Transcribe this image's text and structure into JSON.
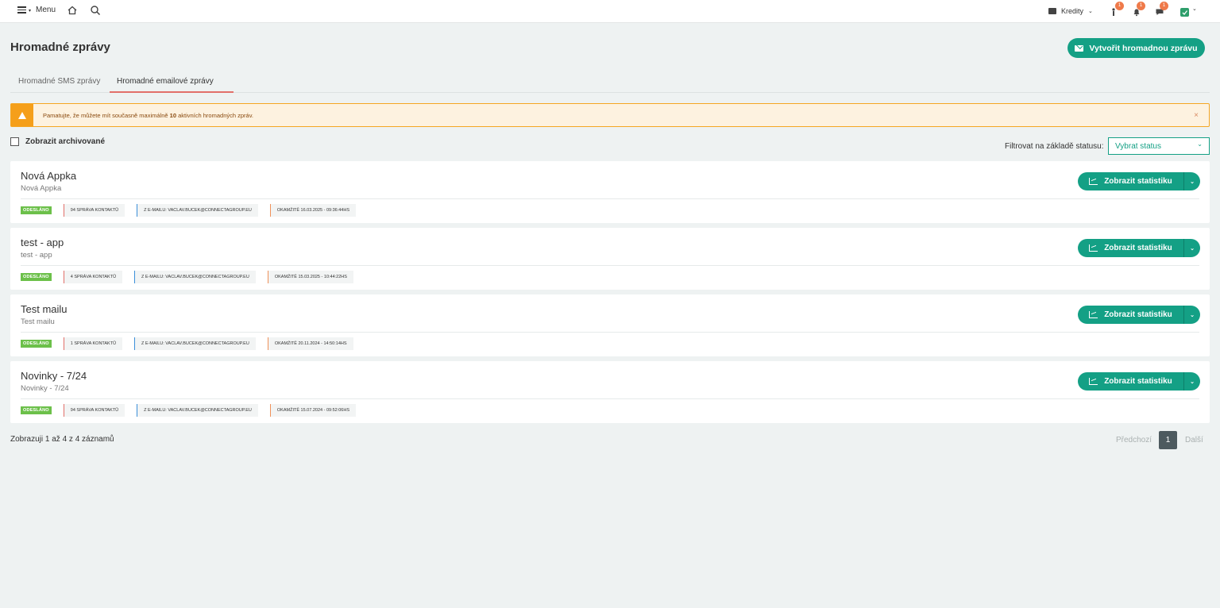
{
  "topbar": {
    "menu_label": "Menu",
    "credits_label": "Kredity",
    "badges": {
      "user": "1",
      "notifications": "1",
      "messages": "1"
    }
  },
  "page": {
    "title": "Hromadné zprávy",
    "create_button": "Vytvořit hromadnou zprávu"
  },
  "tabs": [
    {
      "label": "Hromadné SMS zprávy"
    },
    {
      "label": "Hromadné emailové zprávy"
    }
  ],
  "alert": {
    "text_before": "Pamatujte, že můžete mít současně maximálně ",
    "text_bold": "10",
    "text_after": " aktivních hromadných zpráv.",
    "close": "×"
  },
  "filters": {
    "archived_label": "Zobrazit archivované",
    "status_label": "Filtrovat na základě statusu:",
    "status_select": "Vybrat status"
  },
  "stats_button_label": "Zobrazit statistiku",
  "messages": [
    {
      "title": "Nová Appka",
      "subtitle": "Nová Appka",
      "status": "ODESLÁNO",
      "contacts": "94 SPRÁVA KONTAKTŮ",
      "from": "Z E-MAILU: VACLAV.BUCEK@CONNECTAGROUP.EU",
      "time": "OKAMŽITĚ 16.03.2025 - 09:36:44HS"
    },
    {
      "title": "test - app",
      "subtitle": "test - app",
      "status": "ODESLÁNO",
      "contacts": "4 SPRÁVA KONTAKTŮ",
      "from": "Z E-MAILU: VACLAV.BUCEK@CONNECTAGROUP.EU",
      "time": "OKAMŽITĚ 15.03.2025 - 10:44:22HS"
    },
    {
      "title": "Test mailu",
      "subtitle": "Test mailu",
      "status": "ODESLÁNO",
      "contacts": "1 SPRÁVA KONTAKTŮ",
      "from": "Z E-MAILU: VACLAV.BUCEK@CONNECTAGROUP.EU",
      "time": "OKAMŽITĚ 20.11.2024 - 14:50:14HS"
    },
    {
      "title": "Novinky - 7/24",
      "subtitle": "Novinky - 7/24",
      "status": "ODESLÁNO",
      "contacts": "94 SPRÁVA KONTAKTŮ",
      "from": "Z E-MAILU: VACLAV.BUCEK@CONNECTAGROUP.EU",
      "time": "OKAMŽITĚ 15.07.2024 - 09:52:06HS"
    }
  ],
  "pagination": {
    "info": "Zobrazuji 1 až 4 z 4 záznamů",
    "prev": "Předchozí",
    "current": "1",
    "next": "Další"
  },
  "colors": {
    "accent": "#14a085",
    "status_badge": "#6cc04a",
    "alert_bg": "#fdf2e0",
    "alert_icon": "#f59f1a",
    "tab_underline": "#e2706a",
    "badge": "#ef7a4a"
  },
  "icons": {
    "menu": "hamburger-icon",
    "home": "home-icon",
    "search": "search-icon",
    "credits": "wallet-icon",
    "user": "person-icon",
    "notifications": "bell-icon",
    "messages": "chat-icon",
    "profile": "avatar-icon",
    "create": "envelope-icon",
    "alert": "warning-icon",
    "stats": "chart-icon",
    "dropdown": "chevron-down-icon"
  }
}
